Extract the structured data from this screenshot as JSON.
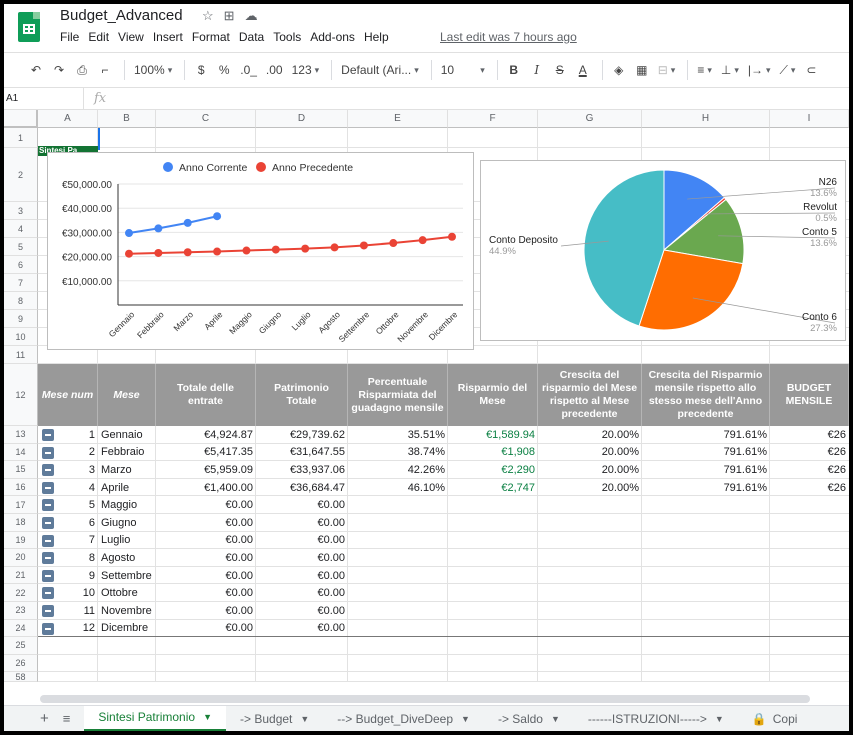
{
  "app": {
    "doc_title": "Budget_Advanced",
    "menu": [
      "File",
      "Edit",
      "View",
      "Insert",
      "Format",
      "Data",
      "Tools",
      "Add-ons",
      "Help"
    ],
    "last_edit": "Last edit was 7 hours ago"
  },
  "toolbar": {
    "zoom": "100%",
    "currency": "$",
    "percent": "%",
    "dec_less": ".0_",
    "dec_more": ".00",
    "num_format": "123",
    "font": "Default (Ari...",
    "font_size": "10",
    "bold": "B",
    "italic": "I",
    "strike": "S",
    "text_color": "A"
  },
  "formula_bar": {
    "cell_ref": "A1",
    "fx": "fx"
  },
  "columns": [
    "A",
    "B",
    "C",
    "D",
    "E",
    "F",
    "G",
    "H",
    "I"
  ],
  "rows": [
    "1",
    "2",
    "3",
    "4",
    "5",
    "6",
    "7",
    "8",
    "9",
    "10",
    "11",
    "12",
    "13",
    "14",
    "15",
    "16",
    "17",
    "18",
    "19",
    "20",
    "21",
    "22",
    "23",
    "24",
    "25",
    "26",
    "58"
  ],
  "a2_text": "Sintesi Pa",
  "table": {
    "headers": [
      "Mese num",
      "Mese",
      "Totale delle entrate",
      "Patrimonio Totale",
      "Percentuale Risparmiata del guadagno mensile",
      "Risparmio del Mese",
      "Crescita del risparmio del Mese rispetto al Mese precedente",
      "Crescita del Risparmio mensile rispetto allo stesso mese dell'Anno precedente",
      "BUDGET MENSILE"
    ],
    "rows": [
      {
        "num": "1",
        "mese": "Gennaio",
        "entrate": "€4,924.87",
        "patrimonio": "€29,739.62",
        "perc": "35.51%",
        "risparmio": "€1,589.94",
        "crescita_m": "20.00%",
        "crescita_a": "791.61%",
        "budget": "€26"
      },
      {
        "num": "2",
        "mese": "Febbraio",
        "entrate": "€5,417.35",
        "patrimonio": "€31,647.55",
        "perc": "38.74%",
        "risparmio": "€1,908",
        "crescita_m": "20.00%",
        "crescita_a": "791.61%",
        "budget": "€26"
      },
      {
        "num": "3",
        "mese": "Marzo",
        "entrate": "€5,959.09",
        "patrimonio": "€33,937.06",
        "perc": "42.26%",
        "risparmio": "€2,290",
        "crescita_m": "20.00%",
        "crescita_a": "791.61%",
        "budget": "€26"
      },
      {
        "num": "4",
        "mese": "Aprile",
        "entrate": "€1,400.00",
        "patrimonio": "€36,684.47",
        "perc": "46.10%",
        "risparmio": "€2,747",
        "crescita_m": "20.00%",
        "crescita_a": "791.61%",
        "budget": "€26"
      },
      {
        "num": "5",
        "mese": "Maggio",
        "entrate": "€0.00",
        "patrimonio": "€0.00",
        "perc": "",
        "risparmio": "",
        "crescita_m": "",
        "crescita_a": "",
        "budget": ""
      },
      {
        "num": "6",
        "mese": "Giugno",
        "entrate": "€0.00",
        "patrimonio": "€0.00",
        "perc": "",
        "risparmio": "",
        "crescita_m": "",
        "crescita_a": "",
        "budget": ""
      },
      {
        "num": "7",
        "mese": "Luglio",
        "entrate": "€0.00",
        "patrimonio": "€0.00",
        "perc": "",
        "risparmio": "",
        "crescita_m": "",
        "crescita_a": "",
        "budget": ""
      },
      {
        "num": "8",
        "mese": "Agosto",
        "entrate": "€0.00",
        "patrimonio": "€0.00",
        "perc": "",
        "risparmio": "",
        "crescita_m": "",
        "crescita_a": "",
        "budget": ""
      },
      {
        "num": "9",
        "mese": "Settembre",
        "entrate": "€0.00",
        "patrimonio": "€0.00",
        "perc": "",
        "risparmio": "",
        "crescita_m": "",
        "crescita_a": "",
        "budget": ""
      },
      {
        "num": "10",
        "mese": "Ottobre",
        "entrate": "€0.00",
        "patrimonio": "€0.00",
        "perc": "",
        "risparmio": "",
        "crescita_m": "",
        "crescita_a": "",
        "budget": ""
      },
      {
        "num": "11",
        "mese": "Novembre",
        "entrate": "€0.00",
        "patrimonio": "€0.00",
        "perc": "",
        "risparmio": "",
        "crescita_m": "",
        "crescita_a": "",
        "budget": ""
      },
      {
        "num": "12",
        "mese": "Dicembre",
        "entrate": "€0.00",
        "patrimonio": "€0.00",
        "perc": "",
        "risparmio": "",
        "crescita_m": "",
        "crescita_a": "",
        "budget": ""
      }
    ]
  },
  "sheet_tabs": [
    {
      "label": "Sintesi Patrimonio",
      "active": true
    },
    {
      "label": "-> Budget",
      "active": false
    },
    {
      "label": "--> Budget_DiveDeep",
      "active": false
    },
    {
      "label": "-> Saldo",
      "active": false
    },
    {
      "label": "------ISTRUZIONI----->",
      "active": false
    },
    {
      "label": "Copi",
      "active": false
    }
  ],
  "colors": {
    "blue": "#4285f4",
    "red": "#ea4335",
    "green": "#6aa84f",
    "orange": "#ff6d01",
    "teal": "#46bdc6",
    "header_gray": "#999999",
    "accent_green": "#188038"
  },
  "chart_data": [
    {
      "type": "line",
      "categories": [
        "Gennaio",
        "Febbraio",
        "Marzo",
        "Aprile",
        "Maggio",
        "Giugno",
        "Luglio",
        "Agosto",
        "Settembre",
        "Ottobre",
        "Novembre",
        "Dicembre"
      ],
      "series": [
        {
          "name": "Anno Corrente",
          "color": "#4285f4",
          "values": [
            29739.62,
            31647.55,
            33937.06,
            36684.47,
            null,
            null,
            null,
            null,
            null,
            null,
            null,
            null
          ]
        },
        {
          "name": "Anno Precedente",
          "color": "#ea4335",
          "values": [
            21200,
            21500,
            21800,
            22100,
            22500,
            22900,
            23300,
            23800,
            24600,
            25600,
            26800,
            28200
          ]
        }
      ],
      "yticks": [
        "€50,000.00",
        "€40,000.00",
        "€30,000.00",
        "€20,000.00",
        "€10,000.00"
      ],
      "ylim": [
        0,
        50000
      ],
      "legend": "top",
      "grid": true
    },
    {
      "type": "pie",
      "slices": [
        {
          "label": "N26",
          "value": 13.6,
          "pct_label": "13.6%",
          "color": "#4285f4"
        },
        {
          "label": "Revolut",
          "value": 0.5,
          "pct_label": "0.5%",
          "color": "#ea4335"
        },
        {
          "label": "Conto 5",
          "value": 13.6,
          "pct_label": "13.6%",
          "color": "#6aa84f"
        },
        {
          "label": "Conto 6",
          "value": 27.3,
          "pct_label": "27.3%",
          "color": "#ff6d01"
        },
        {
          "label": "Conto Deposito",
          "value": 44.9,
          "pct_label": "44.9%",
          "color": "#46bdc6"
        }
      ]
    }
  ]
}
